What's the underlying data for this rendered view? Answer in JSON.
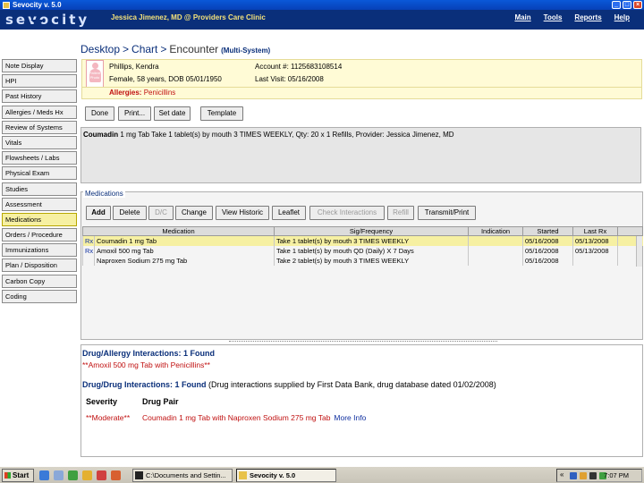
{
  "window": {
    "title": "Sevocity v. 5.0",
    "buttons": [
      "_",
      "□",
      "×"
    ]
  },
  "header": {
    "logo": "sevocity",
    "user": "Jessica Jimenez, MD @ Providers Care Clinic",
    "menu": [
      "Main",
      "Tools",
      "Reports",
      "Help"
    ]
  },
  "breadcrumb": {
    "items": [
      "Desktop",
      "Chart",
      "Encounter"
    ],
    "separator": ">",
    "suffix": "(Multi-System)"
  },
  "nav": [
    "Note Display",
    "HPI",
    "Past History",
    "Allergies / Meds Hx",
    "Review of Systems",
    "Vitals",
    "Flowsheets / Labs",
    "Physical Exam",
    "Studies",
    "Assessment",
    "Medications",
    "Orders / Procedure",
    "Immunizations",
    "Plan / Disposition",
    "Carbon Copy",
    "Coding"
  ],
  "nav_active": "Medications",
  "patient": {
    "photo_label": "Patient Photo",
    "name": "Phillips, Kendra",
    "demographics": "Female, 58 years, DOB 05/01/1950",
    "account": "Account #: 1125683108514",
    "last_visit": "Last Visit: 05/16/2008",
    "allergies_label": "Allergies:",
    "allergies": "Penicillins"
  },
  "toolbar": {
    "done": "Done",
    "print": "Print...",
    "set_date": "Set date",
    "template": "Template"
  },
  "rx_summary": {
    "drug": "Coumadin",
    "detail": "1 mg Tab Take 1 tablet(s) by mouth 3 TIMES WEEKLY, Qty: 20 x 1 Refills, Provider: Jessica Jimenez, MD"
  },
  "medications": {
    "title": "Medications",
    "buttons": {
      "add": "Add",
      "delete": "Delete",
      "dc": "D/C",
      "change": "Change",
      "view_historic": "View Historic",
      "leaflet": "Leaflet",
      "check_interactions": "Check Interactions",
      "refill": "Refill",
      "transmit": "Transmit/Print"
    },
    "columns": [
      "Medication",
      "Sig/Frequency",
      "Indication",
      "Started",
      "Last Rx"
    ],
    "rows": [
      {
        "rx": "Rx",
        "name": "Coumadin 1 mg Tab",
        "sig": "Take 1 tablet(s) by mouth 3 TIMES WEEKLY",
        "indication": "",
        "started": "05/16/2008",
        "last_rx": "05/13/2008"
      },
      {
        "rx": "Rx",
        "name": "Amoxil 500 mg Tab",
        "sig": "Take 1 tablet(s) by mouth QD (Daily) X 7 Days",
        "indication": "",
        "started": "05/16/2008",
        "last_rx": "05/13/2008"
      },
      {
        "rx": "",
        "name": "Naproxen Sodium 275 mg Tab",
        "sig": "Take 2 tablet(s) by mouth 3 TIMES WEEKLY",
        "indication": "",
        "started": "05/16/2008",
        "last_rx": ""
      }
    ]
  },
  "interactions": {
    "allergy_title": "Drug/Allergy Interactions: 1 Found",
    "allergy_item": "**Amoxil 500 mg Tab with Penicillins**",
    "drug_title": "Drug/Drug Interactions: 1 Found",
    "drug_note": "(Drug interactions supplied by First Data Bank, drug database dated 01/02/2008)",
    "col_severity": "Severity",
    "col_pair": "Drug Pair",
    "severity": "**Moderate**",
    "pair": "Coumadin 1 mg Tab with Naproxen Sodium 275 mg Tab",
    "more_info": "More Info"
  },
  "taskbar": {
    "start": "Start",
    "tasks": [
      "C:\\Documents and Settin...",
      "Sevocity v. 5.0"
    ],
    "clock": "7:07 PM"
  },
  "colors": {
    "accent_blue": "#0a2f7a",
    "selected_yellow": "#f6f0a2",
    "alert_red": "#c01010"
  }
}
